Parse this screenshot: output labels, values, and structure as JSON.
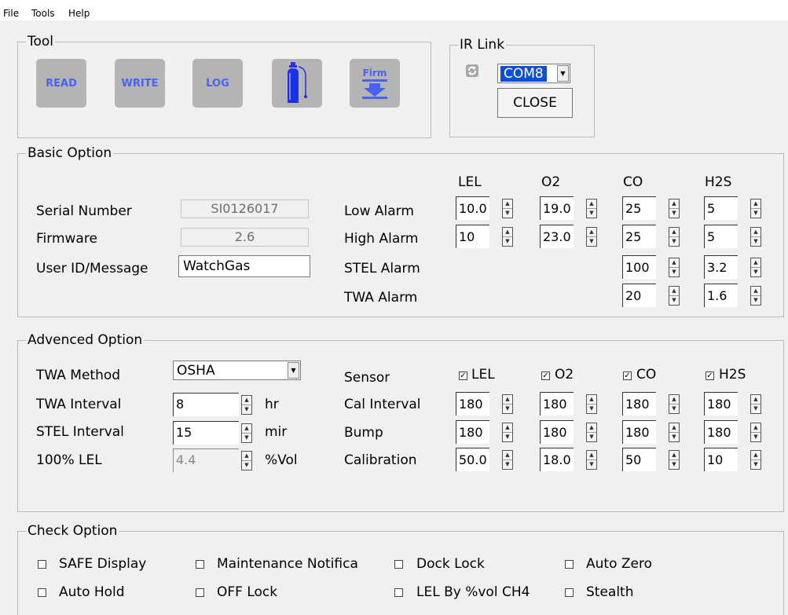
{
  "menu": {
    "file": "File",
    "tools": "Tools",
    "help": "Help"
  },
  "tool": {
    "legend": "Tool",
    "read": "READ",
    "write": "WRITE",
    "log": "LOG",
    "firm": "Firm",
    "gas_icon": "gas-cylinder-icon",
    "download_icon": "download-arrow-icon"
  },
  "ir_link": {
    "legend": "IR Link",
    "port": "COM8",
    "close": "CLOSE",
    "refresh_icon": "refresh-icon"
  },
  "basic": {
    "legend": "Basic Option",
    "columns": [
      "LEL",
      "O2",
      "CO",
      "H2S"
    ],
    "serial_label": "Serial Number",
    "serial_value": "SI0126017",
    "firmware_label": "Firmware",
    "firmware_value": "2.6",
    "user_label": "User ID/Message",
    "user_value": "WatchGas",
    "low_alarm": "Low Alarm",
    "high_alarm": "High Alarm",
    "stel_alarm": "STEL Alarm",
    "twa_alarm": "TWA Alarm",
    "low": [
      "10.0",
      "19.0",
      "25",
      "5"
    ],
    "high": [
      "10",
      "23.0",
      "25",
      "5"
    ],
    "stel": [
      "100",
      "3.2"
    ],
    "twa": [
      "20",
      "1.6"
    ]
  },
  "advanced": {
    "legend": "Advenced Option",
    "twa_method_label": "TWA Method",
    "twa_method_value": "OSHA",
    "twa_interval_label": "TWA Interval",
    "twa_interval_value": "8",
    "twa_interval_unit": "hr",
    "stel_interval_label": "STEL Interval",
    "stel_interval_value": "15",
    "stel_interval_unit": "mir",
    "lel100_label": "100% LEL",
    "lel100_value": "4.4",
    "lel100_unit": "%Vol",
    "sensor_label": "Sensor",
    "cal_interval_label": "Cal Interval",
    "bump_label": "Bump",
    "calibration_label": "Calibration",
    "sensors": [
      "LEL",
      "O2",
      "CO",
      "H2S"
    ],
    "cal": [
      "180",
      "180",
      "180",
      "180"
    ],
    "bump": [
      "180",
      "180",
      "180",
      "180"
    ],
    "calibration": [
      "50.0",
      "18.0",
      "50",
      "10"
    ]
  },
  "check": {
    "legend": "Check Option",
    "safe_display": "SAFE Display",
    "maintenance": "Maintenance Notifica",
    "dock_lock": "Dock Lock",
    "auto_zero": "Auto Zero",
    "auto_hold": "Auto Hold",
    "off_lock": "OFF Lock",
    "lel_ch4": "LEL By %vol CH4",
    "stealth": "Stealth"
  }
}
